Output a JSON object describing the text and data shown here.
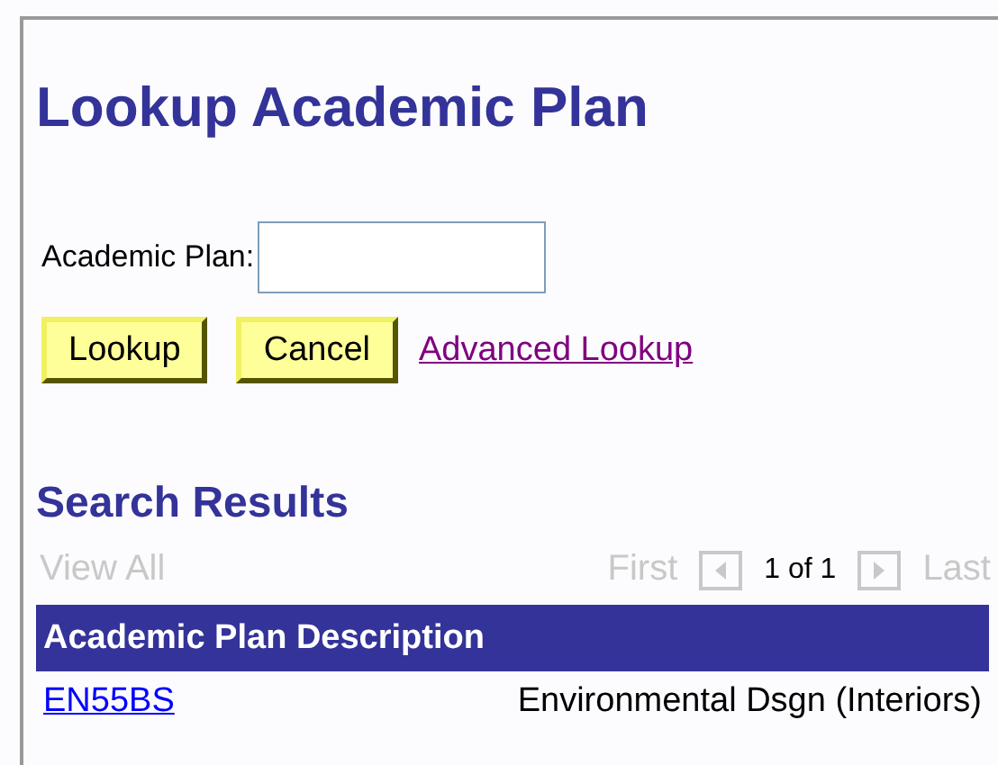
{
  "title": "Lookup Academic Plan",
  "search": {
    "label": "Academic Plan:"
  },
  "buttons": [
    {
      "label": "Lookup",
      "kind": "button"
    },
    {
      "label": "Cancel",
      "kind": "button"
    },
    {
      "label": "Advanced Lookup",
      "kind": "link"
    }
  ],
  "results": {
    "title": "Search Results",
    "view_all": {
      "label": "View All",
      "disabled": true
    },
    "first": {
      "label": "First",
      "disabled": true
    },
    "prev": {
      "disabled": true
    },
    "count": "1 of 1",
    "next": {
      "disabled": true
    },
    "last": {
      "label": "Last",
      "disabled": true
    },
    "header": "Academic Plan Description",
    "rows": [
      {
        "code": "EN55BS",
        "description": "Environmental Dsgn (Interiors)"
      }
    ]
  }
}
